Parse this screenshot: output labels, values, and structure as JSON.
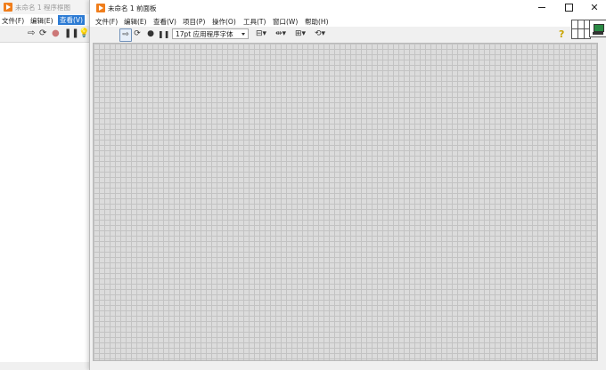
{
  "block_diagram": {
    "title": "未命名 1 程序框图",
    "menu": [
      "文件(F)",
      "编辑(E)",
      "查看(V)"
    ],
    "toolbar_icons": [
      "run-icon",
      "run-continuously-icon",
      "abort-icon",
      "pause-icon",
      "highlight-execution-icon"
    ]
  },
  "front_panel": {
    "title": "未命名 1 前面板",
    "window_controls": {
      "close": "✕"
    },
    "menu": [
      "文件(F)",
      "编辑(E)",
      "查看(V)",
      "项目(P)",
      "操作(O)",
      "工具(T)",
      "窗口(W)",
      "帮助(H)"
    ],
    "toolbar": {
      "font_select": "17pt 应用程序字体",
      "help_glyph": "?",
      "icons": [
        "run-icon",
        "run-continuously-icon",
        "abort-icon",
        "pause-icon",
        "align-icon",
        "distribute-icon",
        "resize-icon",
        "reorder-icon"
      ]
    }
  },
  "colors": {
    "accent": "#f07e1c",
    "menu_highlight": "#2c7bd4",
    "grid": "#dcdcdc"
  }
}
